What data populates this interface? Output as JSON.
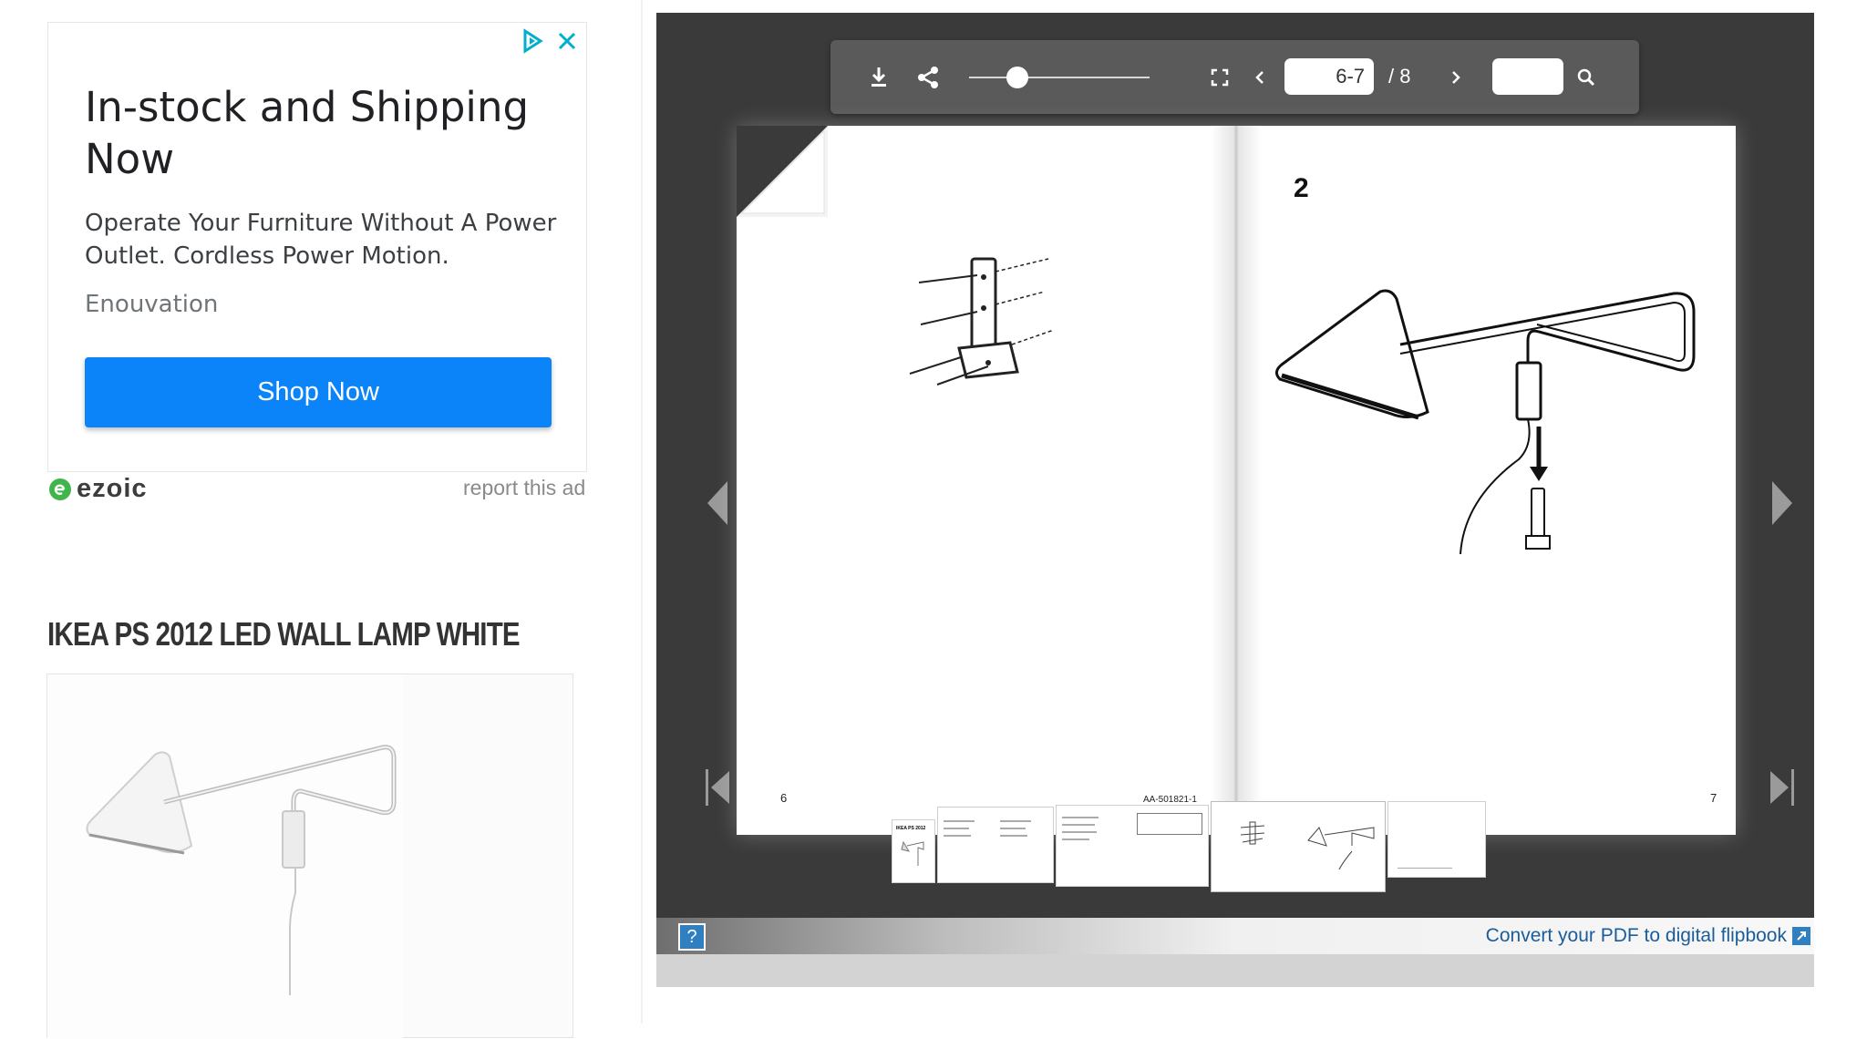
{
  "ad": {
    "headline": "In-stock and Shipping Now",
    "body": "Operate Your Furniture Without A Power Outlet. Cordless Power Motion.",
    "advertiser": "Enouvation",
    "cta_label": "Shop Now",
    "network_brand": "ezoic",
    "report_label": "report this ad",
    "accent_color": "#0b84f9"
  },
  "product": {
    "title": "IKEA PS 2012 LED WALL LAMP WHITE"
  },
  "viewer": {
    "page_field_value": "6-7",
    "page_total": "/ 8",
    "search_value": "",
    "zoom_level": 0.27,
    "left_page": {
      "page_number": "6",
      "doc_code": "AA-501821-1"
    },
    "right_page": {
      "step_number": "2",
      "page_number": "7"
    },
    "help_label": "?",
    "convert_link": "Convert your PDF to digital flipbook",
    "thumbnails": [
      {
        "label": "IKEA PS 2012"
      }
    ],
    "icons": [
      "download-icon",
      "share-icon",
      "fullscreen-icon",
      "chevron-left-icon",
      "chevron-right-icon",
      "search-icon",
      "first-page-icon",
      "last-page-icon",
      "external-link-icon"
    ]
  }
}
